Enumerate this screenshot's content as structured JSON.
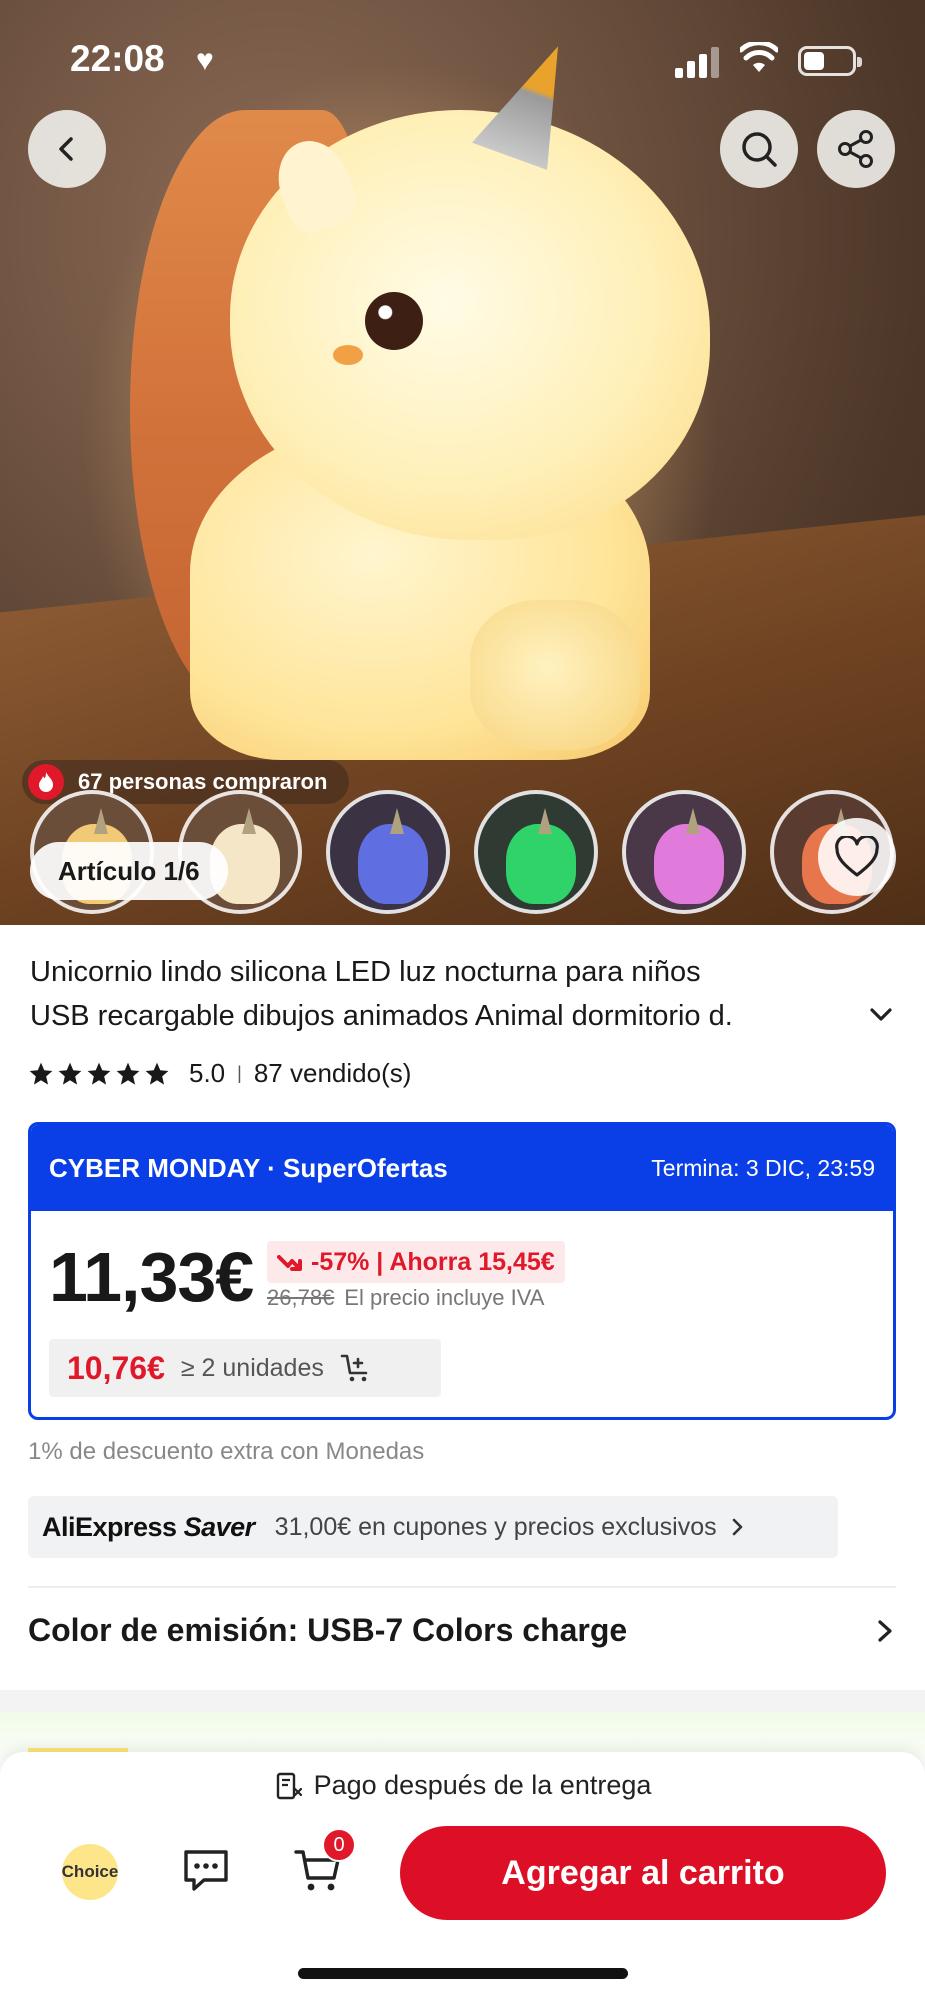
{
  "status_bar": {
    "time": "22:08"
  },
  "gallery": {
    "buyers": "67 personas compraron",
    "article_counter": "Artículo 1/6",
    "thumbnail_colors": [
      "#f2c977",
      "#f6e6c8",
      "#5f6ee0",
      "#2fd36a",
      "#e07bdc",
      "#e8764c"
    ]
  },
  "product": {
    "title_line1": "Unicornio lindo silicona LED luz nocturna para niños",
    "title_line2": "USB recargable dibujos animados Animal dormitorio d.",
    "rating": "5.0",
    "sold": "87 vendido(s)"
  },
  "promo": {
    "title": "CYBER MONDAY · SuperOfertas",
    "ends": "Termina: 3 DIC, 23:59",
    "price": "11,33€",
    "discount": "-57% | Ahorra 15,45€",
    "old_price": "26,78€",
    "vat_note": "El precio incluye IVA",
    "tier_price": "10,76€",
    "tier_qty": "≥ 2 unidades"
  },
  "coins_note": "1% de descuento extra con Monedas",
  "saver": {
    "logo_brand": "AliExpress",
    "logo_saver": "Saver",
    "text": "31,00€ en cupones y precios exclusivos"
  },
  "variant": {
    "label": "Color de emisión: USB-7 Colors charge"
  },
  "bottom_bar": {
    "pay_after": "Pago después de la entrega",
    "choice": "Choice",
    "cart_count": "0",
    "add_to_cart": "Agregar al carrito"
  },
  "colors": {
    "accent_red": "#dd0f26",
    "promo_blue": "#0a3fe8"
  }
}
